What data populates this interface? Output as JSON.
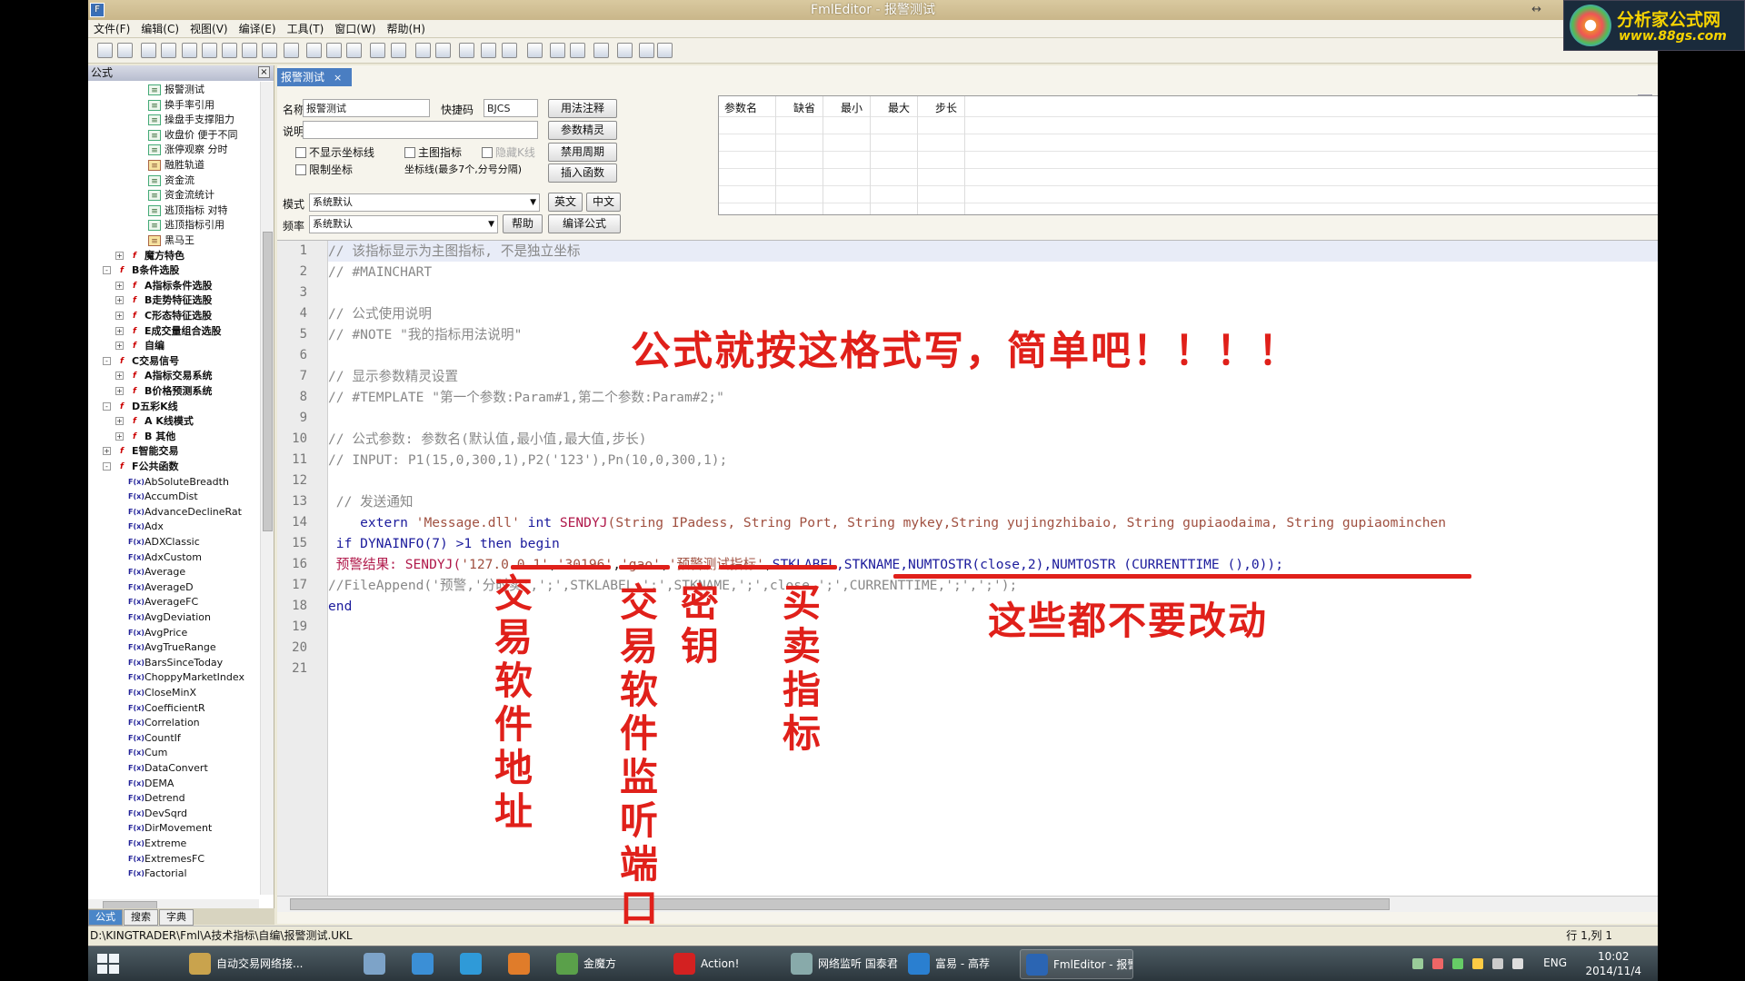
{
  "window": {
    "title": "FmlEditor - 报警测试",
    "restore_glyph": "↔"
  },
  "logo": {
    "line1": "分析家公式网",
    "line2": "www.88gs.com"
  },
  "menu": [
    "文件(F)",
    "编辑(C)",
    "视图(V)",
    "编译(E)",
    "工具(T)",
    "窗口(W)",
    "帮助(H)"
  ],
  "left_panel": {
    "title": "公式",
    "tree": [
      {
        "label": "报警测试",
        "icon": "doc",
        "level": 3
      },
      {
        "label": "换手率引用",
        "icon": "doc",
        "level": 3
      },
      {
        "label": "操盘手支撑阻力",
        "icon": "doc",
        "level": 3
      },
      {
        "label": "收盘价 便于不同",
        "icon": "doc",
        "level": 3
      },
      {
        "label": "涨停观察 分时",
        "icon": "doc",
        "level": 3
      },
      {
        "label": "融胜轨道",
        "icon": "doc2",
        "level": 3
      },
      {
        "label": "资金流",
        "icon": "doc",
        "level": 3
      },
      {
        "label": "资金流统计",
        "icon": "doc",
        "level": 3
      },
      {
        "label": "逃顶指标 对特",
        "icon": "doc",
        "level": 3
      },
      {
        "label": "逃顶指标引用",
        "icon": "doc",
        "level": 3
      },
      {
        "label": "黑马王",
        "icon": "doc2",
        "level": 3
      },
      {
        "label": "魔方特色",
        "icon": "cat",
        "level": 2,
        "bold": true,
        "exp": "+"
      },
      {
        "label": "B条件选股",
        "icon": "cat",
        "level": 1,
        "bold": true,
        "exp": "-"
      },
      {
        "label": "A指标条件选股",
        "icon": "cat",
        "level": 2,
        "bold": true,
        "exp": "+"
      },
      {
        "label": "B走势特征选股",
        "icon": "cat",
        "level": 2,
        "bold": true,
        "exp": "+"
      },
      {
        "label": "C形态特征选股",
        "icon": "cat",
        "level": 2,
        "bold": true,
        "exp": "+"
      },
      {
        "label": "E成交量组合选股",
        "icon": "cat",
        "level": 2,
        "bold": true,
        "exp": "+"
      },
      {
        "label": "自编",
        "icon": "cat",
        "level": 2,
        "bold": true,
        "exp": "+"
      },
      {
        "label": "C交易信号",
        "icon": "cat",
        "level": 1,
        "bold": true,
        "exp": "-"
      },
      {
        "label": "A指标交易系统",
        "icon": "cat",
        "level": 2,
        "bold": true,
        "exp": "+"
      },
      {
        "label": "B价格预测系统",
        "icon": "cat",
        "level": 2,
        "bold": true,
        "exp": "+"
      },
      {
        "label": "D五彩K线",
        "icon": "cat",
        "level": 1,
        "bold": true,
        "exp": "-"
      },
      {
        "label": "A K线模式",
        "icon": "cat",
        "level": 2,
        "bold": true,
        "exp": "+"
      },
      {
        "label": "B 其他",
        "icon": "cat",
        "level": 2,
        "bold": true,
        "exp": "+"
      },
      {
        "label": "E智能交易",
        "icon": "cat",
        "level": 1,
        "bold": true,
        "exp": "+"
      },
      {
        "label": "F公共函数",
        "icon": "cat",
        "level": 1,
        "bold": true,
        "exp": "-"
      },
      {
        "label": "AbSoluteBreadth",
        "icon": "fn",
        "level": 2
      },
      {
        "label": "AccumDist",
        "icon": "fn",
        "level": 2
      },
      {
        "label": "AdvanceDeclineRat",
        "icon": "fn",
        "level": 2
      },
      {
        "label": "Adx",
        "icon": "fn",
        "level": 2
      },
      {
        "label": "ADXClassic",
        "icon": "fn",
        "level": 2
      },
      {
        "label": "AdxCustom",
        "icon": "fn",
        "level": 2
      },
      {
        "label": "Average",
        "icon": "fn",
        "level": 2
      },
      {
        "label": "AverageD",
        "icon": "fn",
        "level": 2
      },
      {
        "label": "AverageFC",
        "icon": "fn",
        "level": 2
      },
      {
        "label": "AvgDeviation",
        "icon": "fn",
        "level": 2
      },
      {
        "label": "AvgPrice",
        "icon": "fn",
        "level": 2
      },
      {
        "label": "AvgTrueRange",
        "icon": "fn",
        "level": 2
      },
      {
        "label": "BarsSinceToday",
        "icon": "fn",
        "level": 2
      },
      {
        "label": "ChoppyMarketIndex",
        "icon": "fn",
        "level": 2
      },
      {
        "label": "CloseMinX",
        "icon": "fn",
        "level": 2
      },
      {
        "label": "CoefficientR",
        "icon": "fn",
        "level": 2
      },
      {
        "label": "Correlation",
        "icon": "fn",
        "level": 2
      },
      {
        "label": "CountIf",
        "icon": "fn",
        "level": 2
      },
      {
        "label": "Cum",
        "icon": "fn",
        "level": 2
      },
      {
        "label": "DataConvert",
        "icon": "fn",
        "level": 2
      },
      {
        "label": "DEMA",
        "icon": "fn",
        "level": 2
      },
      {
        "label": "Detrend",
        "icon": "fn",
        "level": 2
      },
      {
        "label": "DevSqrd",
        "icon": "fn",
        "level": 2
      },
      {
        "label": "DirMovement",
        "icon": "fn",
        "level": 2
      },
      {
        "label": "Extreme",
        "icon": "fn",
        "level": 2
      },
      {
        "label": "ExtremesFC",
        "icon": "fn",
        "level": 2
      },
      {
        "label": "Factorial",
        "icon": "fn",
        "level": 2
      }
    ],
    "tabs": [
      "公式",
      "搜索",
      "字典"
    ]
  },
  "doc_tab": {
    "label": "报警测试",
    "close": "×"
  },
  "form": {
    "name_label": "名称",
    "name_value": "报警测试",
    "hotkey_label": "快捷码",
    "hotkey_value": "BJCS",
    "desc_label": "说明",
    "desc_value": "",
    "btn_usage": "用法注释",
    "btn_param_wizard": "参数精灵",
    "btn_disable_period": "禁用周期",
    "btn_insert_func": "插入函数",
    "chk_no_axis": "不显示坐标线",
    "chk_main_chart": "主图指标",
    "chk_hide_k": "隐藏K线",
    "chk_limit_axis": "限制坐标",
    "axis_hint": "坐标线(最多7个,分号分隔)",
    "mode_label": "模式",
    "mode_value": "系统默认",
    "btn_en": "英文",
    "btn_cn": "中文",
    "freq_label": "频率",
    "freq_value": "系统默认",
    "btn_help": "帮助",
    "btn_compile": "编译公式",
    "param_headers": [
      "参数名",
      "缺省",
      "最小",
      "最大",
      "步长"
    ]
  },
  "code": {
    "line_numbers": [
      "1",
      "2",
      "3",
      "4",
      "5",
      "6",
      "7",
      "8",
      "9",
      "10",
      "11",
      "12",
      "13",
      "14",
      "15",
      "16",
      "17",
      "18",
      "19",
      "20",
      "21"
    ],
    "l1": "// 该指标显示为主图指标, 不是独立坐标",
    "l2": "// #MAINCHART",
    "l4": "// 公式使用说明",
    "l5": "// #NOTE \"我的指标用法说明\"",
    "l7": "// 显示参数精灵设置",
    "l8": "// #TEMPLATE \"第一个参数:Param#1,第二个参数:Param#2;\"",
    "l10": "// 公式参数: 参数名(默认值,最小值,最大值,步长)",
    "l11": "// INPUT: P1(15,0,300,1),P2('123'),Pn(10,0,300,1);",
    "l13": " // 发送通知",
    "l14_kw": "    extern ",
    "l14_str": "'Message.dll'",
    "l14_rest": " int ",
    "l14_fn": "SENDYJ",
    "l14_args": "(String IPadess, String Port, String mykey,String yujingzhibaio, String gupiaodaima, String gupiaominchen",
    "l15_kw": " if ",
    "l15_rest": "DYNAINFO(7) >1 then begin",
    "l16_label": " 预警结果: ",
    "l16_fn": "SENDYJ(",
    "l16_ip": "'127.0.0.1'",
    "l16_c1": ",",
    "l16_port": "'30196'",
    "l16_c2": ",",
    "l16_key": "'gao'",
    "l16_c3": ",",
    "l16_ind": "'预警测试指标'",
    "l16_c4": ",",
    "l16_rest": "STKLABEL,STKNAME,NUMTOSTR(close,2),NUMTOSTR (CURRENTTIME (),0));",
    "l17": "//FileAppend('预警",
    "l17_b": ",'分时卖',';',STKLABEL,';',STKNAME,';',close,';',CURRENTTIME,';',';');",
    "l18": "end"
  },
  "annotations": {
    "headline": "公式就按这格式写，简单吧！！！！",
    "ip_note": "交易软件地址",
    "port_note": "交易软件监听端口",
    "key_note": "密钥",
    "ind_note": "买卖指标",
    "rest_note": "这些都不要改动"
  },
  "statusbar": {
    "path": "D:\\KINGTRADER\\Fml\\A技术指标\\自编\\报警测试.UKL",
    "cursor": "行 1,列 1"
  },
  "taskbar": {
    "items": [
      "自动交易网络接...",
      "",
      "",
      "",
      "",
      "金魔方",
      "Action!",
      "网络监听 国泰君...",
      "富易 - 高荐",
      "FmlEditor - 报警..."
    ],
    "lang": "ENG",
    "time": "10:02",
    "date": "2014/11/4"
  },
  "colors": {
    "accent": "#4a7ec2",
    "annotation": "#e0201a",
    "taskbar": "#2b363c"
  }
}
